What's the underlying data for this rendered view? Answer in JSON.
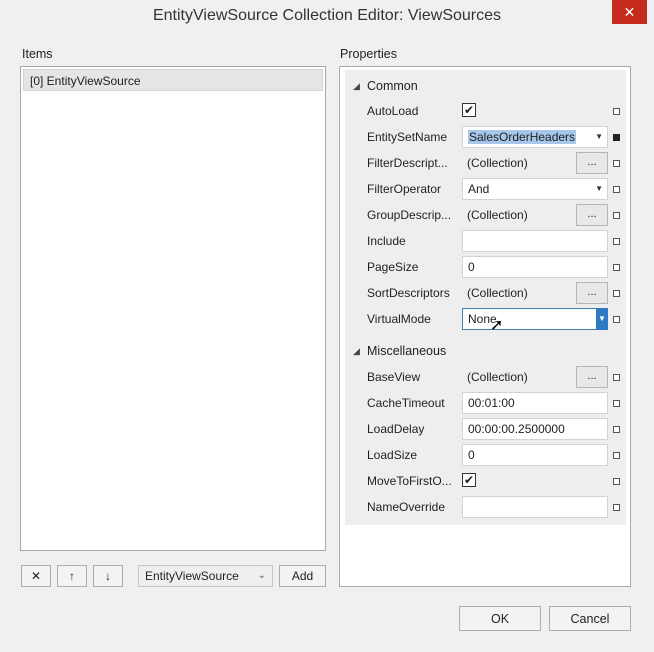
{
  "window": {
    "title": "EntityViewSource Collection Editor: ViewSources",
    "close_glyph": "✕"
  },
  "items": {
    "label": "Items",
    "list": [
      "[0] EntityViewSource"
    ],
    "remove_glyph": "✕",
    "up_glyph": "↑",
    "down_glyph": "↓",
    "type_combo": "EntityViewSource",
    "add_label": "Add"
  },
  "properties": {
    "label": "Properties",
    "categories": [
      {
        "name": "Common",
        "rows": [
          {
            "name": "AutoLoad",
            "checked": true
          },
          {
            "name": "EntitySetName",
            "value": "SalesOrderHeaders"
          },
          {
            "name": "FilterDescript...",
            "value": "(Collection)",
            "ellipsis": "..."
          },
          {
            "name": "FilterOperator",
            "value": "And"
          },
          {
            "name": "GroupDescrip...",
            "value": "(Collection)",
            "ellipsis": "..."
          },
          {
            "name": "Include",
            "value": ""
          },
          {
            "name": "PageSize",
            "value": "0"
          },
          {
            "name": "SortDescriptors",
            "value": "(Collection)",
            "ellipsis": "..."
          },
          {
            "name": "VirtualMode",
            "value": "None"
          }
        ]
      },
      {
        "name": "Miscellaneous",
        "rows": [
          {
            "name": "BaseView",
            "value": "(Collection)",
            "ellipsis": "..."
          },
          {
            "name": "CacheTimeout",
            "value": "00:01:00"
          },
          {
            "name": "LoadDelay",
            "value": "00:00:00.2500000"
          },
          {
            "name": "LoadSize",
            "value": "0"
          },
          {
            "name": "MoveToFirstO...",
            "checked": true
          },
          {
            "name": "NameOverride",
            "value": ""
          }
        ]
      }
    ]
  },
  "footer": {
    "ok_label": "OK",
    "cancel_label": "Cancel"
  }
}
